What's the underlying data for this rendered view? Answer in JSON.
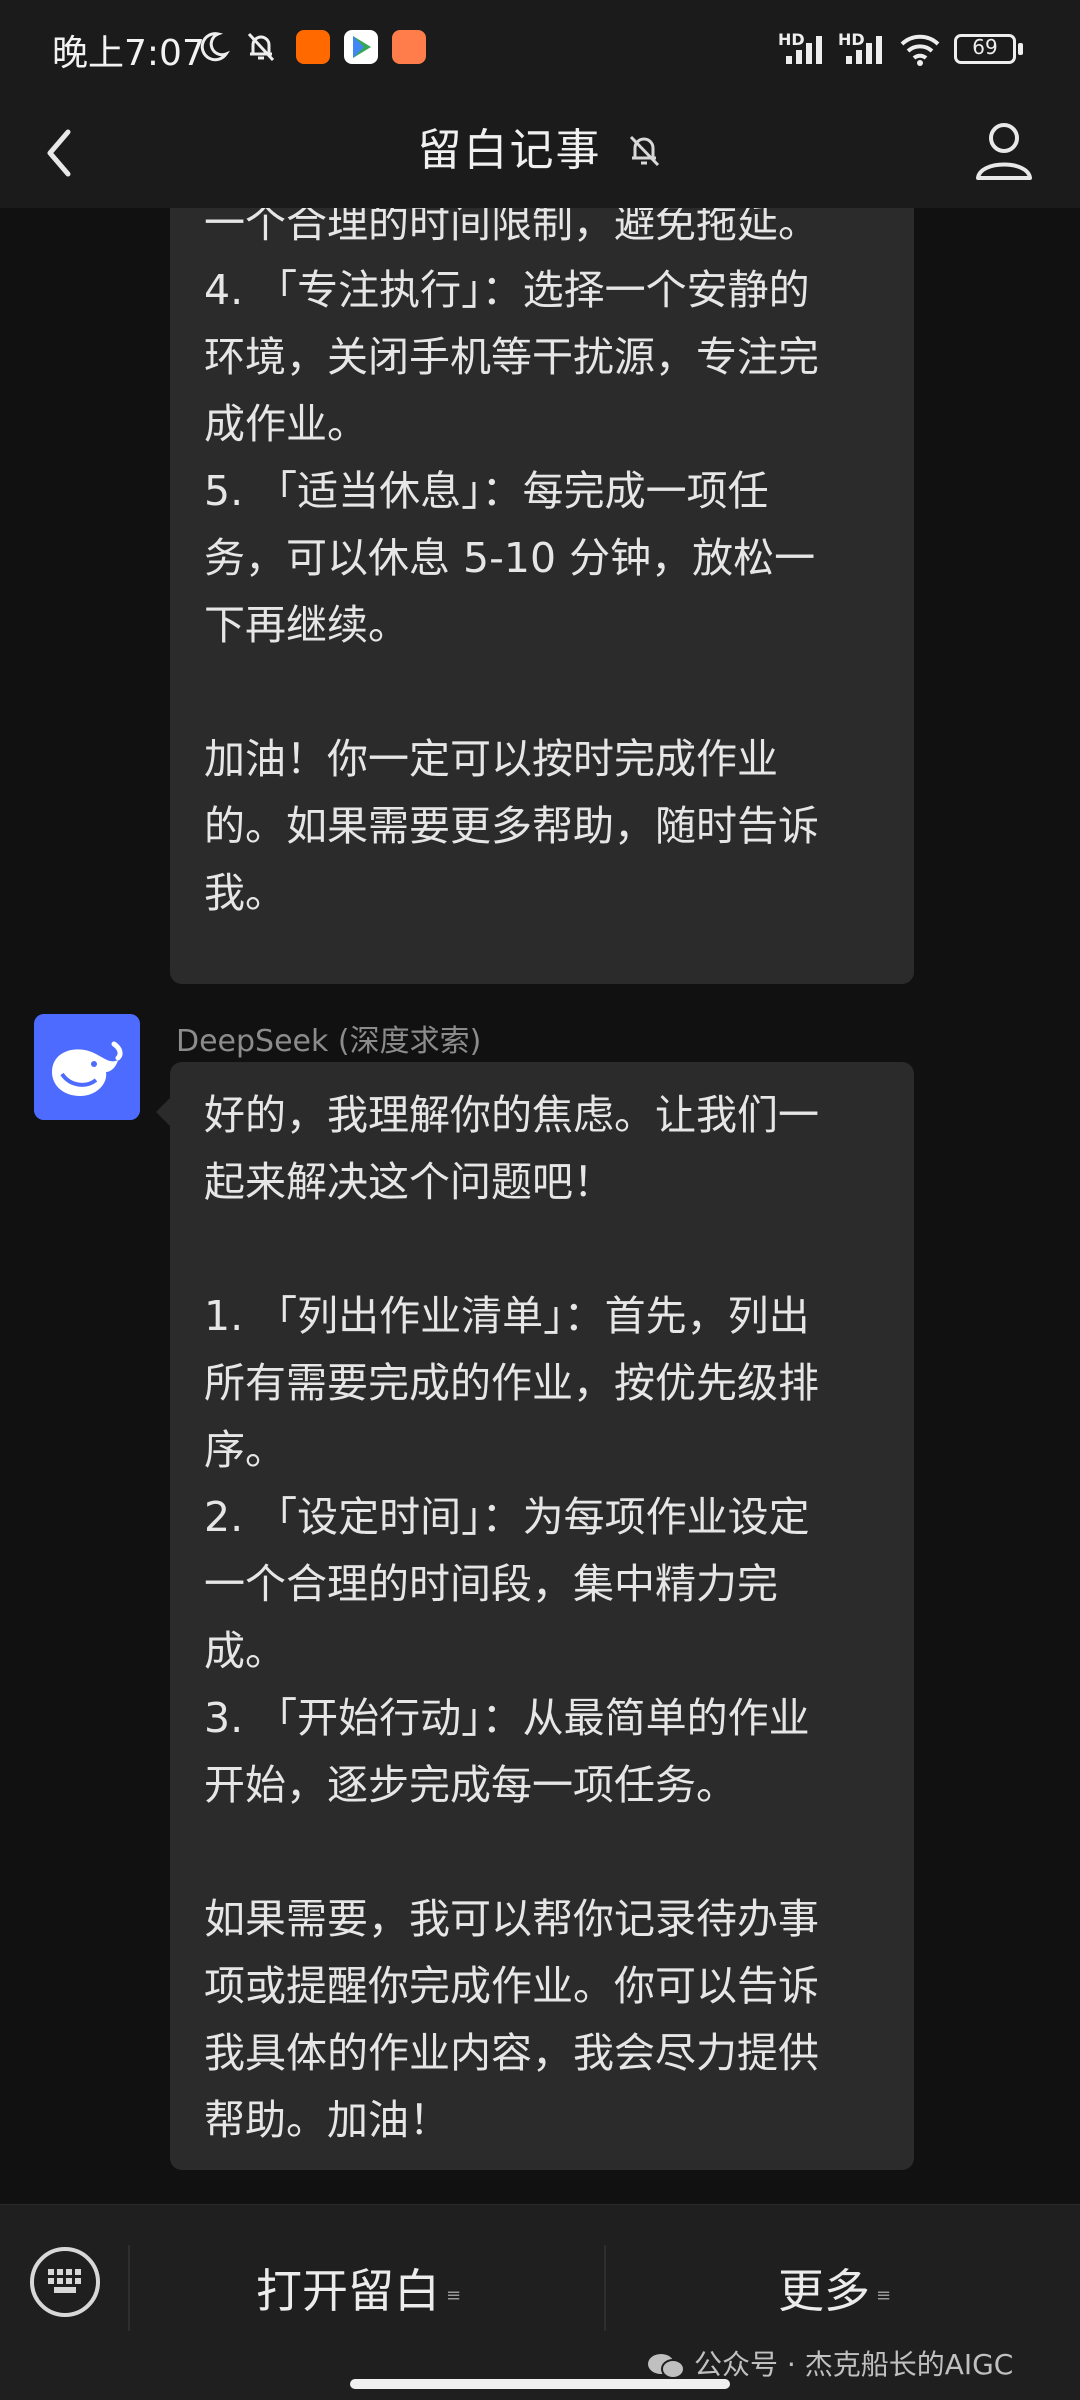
{
  "status_bar": {
    "time": "晚上7:07",
    "hd1": "HD",
    "hd2": "HD",
    "battery": "69",
    "icons": [
      "moon-icon",
      "bell-off-icon",
      "mi-app-icon",
      "play-store-icon",
      "mi-store-icon",
      "signal-icon",
      "wifi-icon",
      "battery-icon"
    ]
  },
  "header": {
    "title": "留白记事",
    "back_icon": "chevron-left-icon",
    "mute_icon": "bell-off-icon",
    "profile_icon": "person-icon"
  },
  "messages": [
    {
      "lines": [
        "一个合理的时间限制，避免拖延。",
        "4. 「专注执行」：选择一个安静的",
        "环境，关闭手机等干扰源，专注完",
        "成作业。",
        "5. 「适当休息」：每完成一项任",
        "务，可以休息 5-10 分钟，放松一",
        "下再继续。",
        "",
        "加油！你一定可以按时完成作业",
        "的。如果需要更多帮助，随时告诉",
        "我。"
      ]
    },
    {
      "sender": "DeepSeek (深度求索)",
      "avatar_icon": "deepseek-whale-icon",
      "lines": [
        "好的，我理解你的焦虑。让我们一",
        "起来解决这个问题吧！",
        "",
        "1. 「列出作业清单」：首先，列出",
        "所有需要完成的作业，按优先级排",
        "序。",
        "2. 「设定时间」：为每项作业设定",
        "一个合理的时间段，集中精力完",
        "成。",
        "3. 「开始行动」：从最简单的作业",
        "开始，逐步完成每一项任务。",
        "",
        "如果需要，我可以帮你记录待办事",
        "项或提醒你完成作业。你可以告诉",
        "我具体的作业内容，我会尽力提供",
        "帮助。加油！"
      ]
    }
  ],
  "bottom_bar": {
    "keyboard_icon": "keyboard-icon",
    "menu1": "打开留白",
    "menu2": "更多",
    "watermark": "公众号 · 杰克船长的AIGC"
  },
  "colors": {
    "background": "#111111",
    "bubble": "#2b2b2b",
    "avatar": "#4d6bfe"
  }
}
